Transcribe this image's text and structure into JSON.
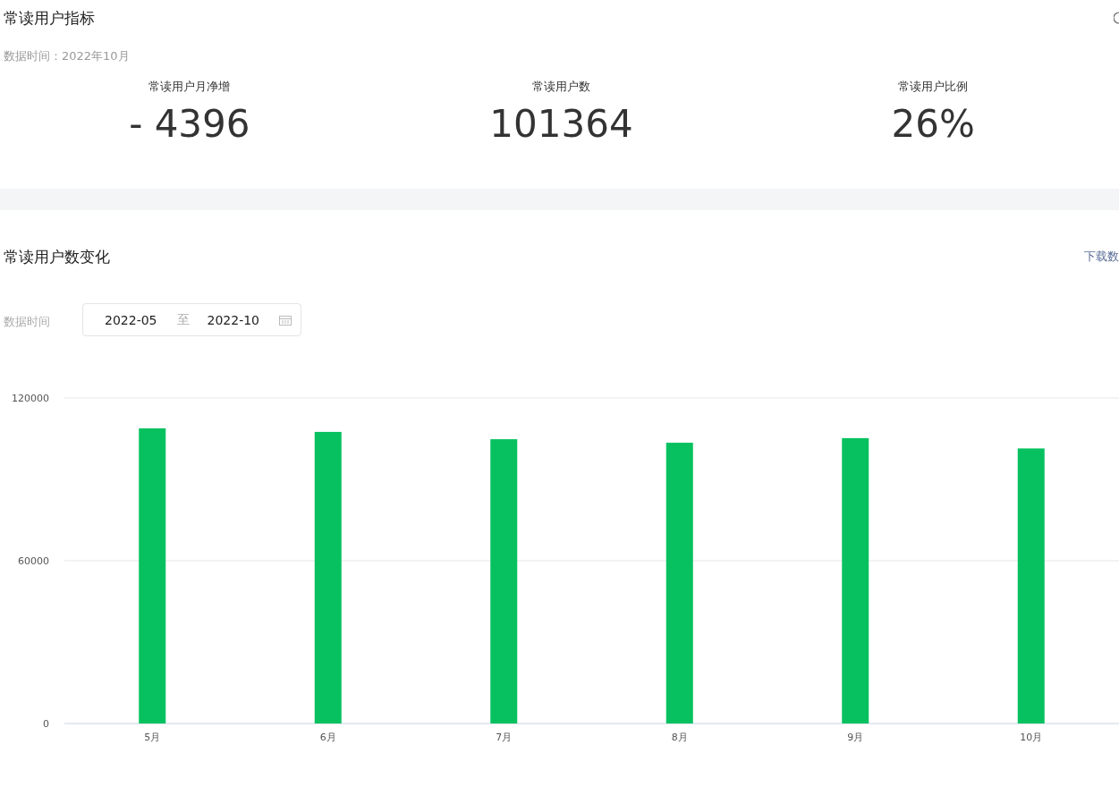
{
  "overview": {
    "title": "常读用户指标",
    "data_time": "数据时间：2022年10月",
    "metrics": [
      {
        "label": "常读用户月净增",
        "value": "- 4396"
      },
      {
        "label": "常读用户数",
        "value": "101364"
      },
      {
        "label": "常读用户比例",
        "value": "26%"
      }
    ]
  },
  "trend": {
    "title": "常读用户数变化",
    "download": "下载数",
    "filter_label": "数据时间",
    "date_range": {
      "start": "2022-05",
      "separator": "至",
      "end": "2022-10"
    },
    "chart_data": {
      "type": "bar",
      "categories": [
        "5月",
        "6月",
        "7月",
        "8月",
        "9月",
        "10月"
      ],
      "series": [
        {
          "color": "#07c160",
          "values": [
            108800,
            107500,
            104800,
            103500,
            105200,
            101400
          ]
        }
      ],
      "ylim": [
        0,
        120000
      ],
      "yticks": [
        0,
        60000,
        120000
      ]
    }
  }
}
